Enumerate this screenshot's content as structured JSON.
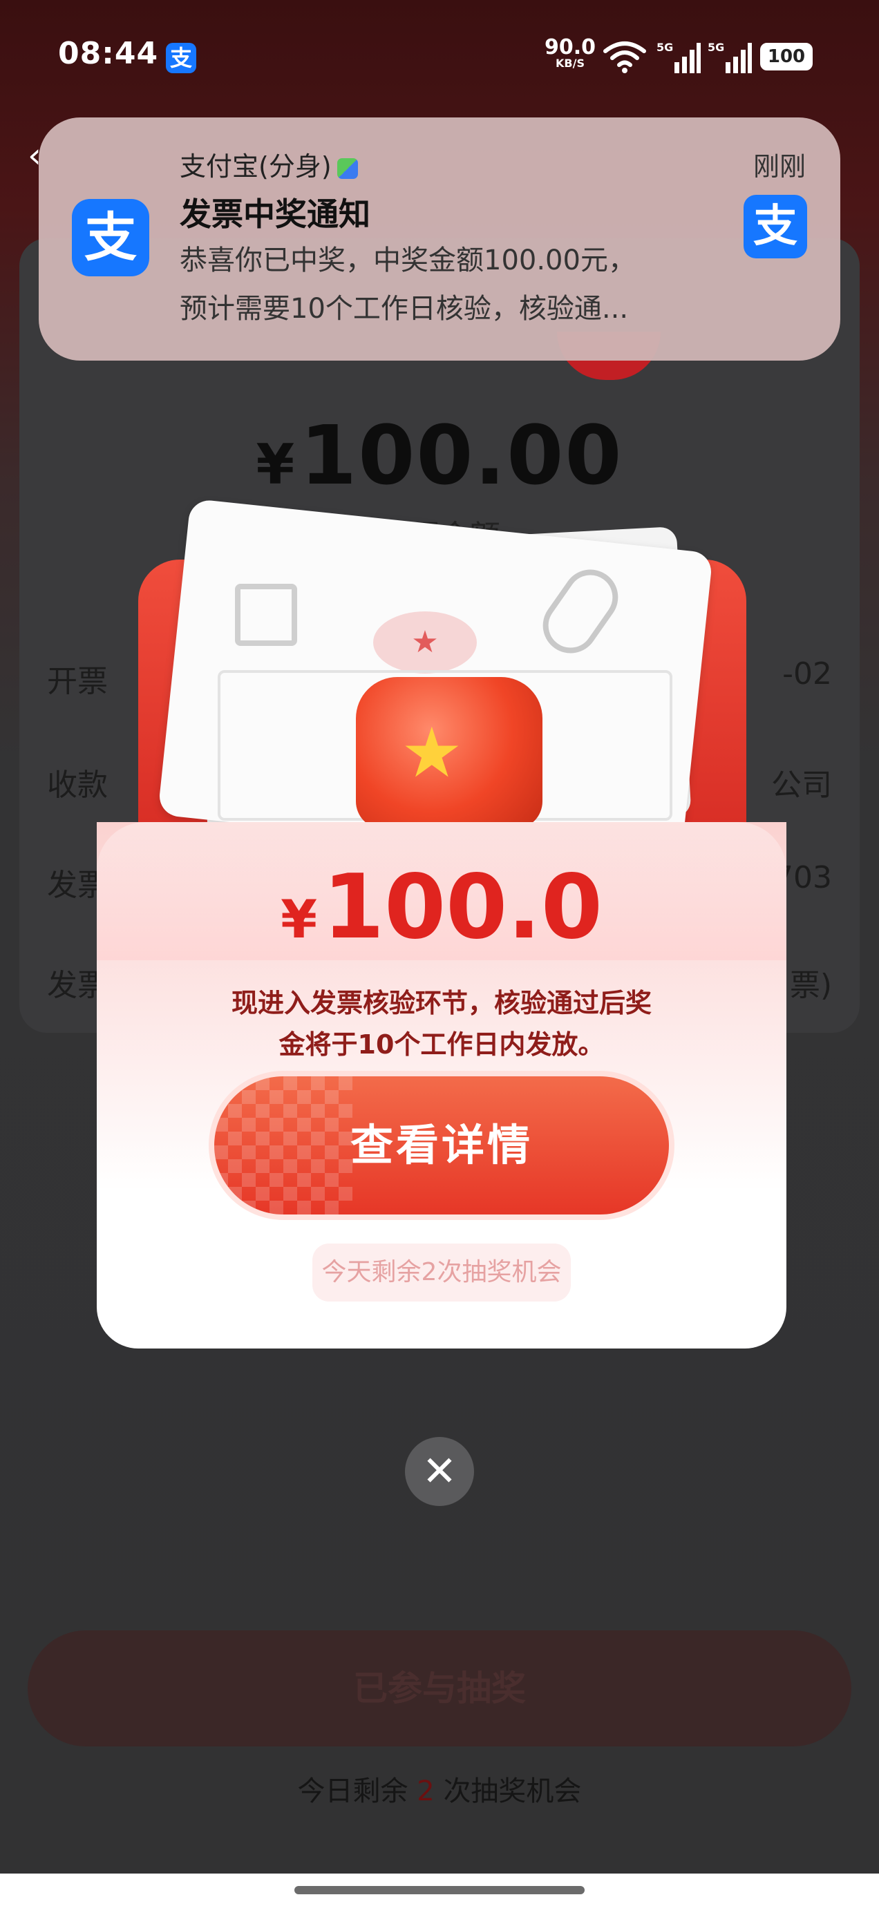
{
  "status_bar": {
    "time": "08:44",
    "app_badge": "支",
    "net_speed": "90.0",
    "net_unit": "KB/S",
    "signal1": "5G",
    "signal2": "5G",
    "battery": "100"
  },
  "notification": {
    "app_icon": "支",
    "app_name": "支付宝(分身)",
    "time": "刚刚",
    "title": "发票中奖通知",
    "body_line1": "恭喜你已中奖，中奖金额100.00元，",
    "body_line2": "预计需要10个工作日核验，核验通..."
  },
  "invoice": {
    "currency": "¥",
    "amount": "100.00",
    "amount_caption": "开票金额",
    "rows": [
      {
        "label": "开票",
        "value": "-02"
      },
      {
        "label": "收款",
        "value": "公司"
      },
      {
        "label": "发票",
        "value": "703"
      },
      {
        "label": "发票",
        "value": "票)"
      }
    ]
  },
  "popup": {
    "currency": "¥",
    "amount": "100.0",
    "desc_line1": "现进入发票核验环节，核验通过后奖",
    "desc_line2": "金将于10个工作日内发放。",
    "details_button": "查看详情",
    "chance_text": "今天剩余2次抽奖机会",
    "close_symbol": "✕"
  },
  "bottom": {
    "join_button": "已参与抽奖",
    "remain_prefix": "今日剩余",
    "remain_count": "2",
    "remain_suffix": "次抽奖机会"
  },
  "colors": {
    "accent_red": "#e0241f",
    "alipay_blue": "#1677ff"
  }
}
